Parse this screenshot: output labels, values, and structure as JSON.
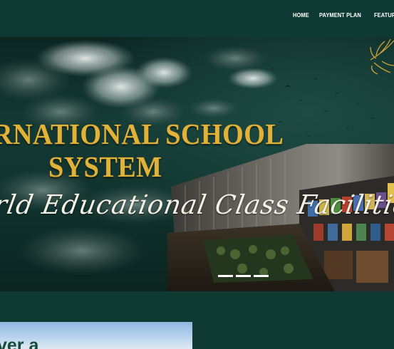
{
  "nav": {
    "items": [
      {
        "label": "HOME"
      },
      {
        "label": "PAYMENT PLAN"
      },
      {
        "label": "FEATUR"
      }
    ]
  },
  "hero": {
    "title_line1": "RNATIONAL SCHOOL",
    "title_line2": "SYSTEM",
    "tagline": "rld Educational Class Facilities",
    "slide_count": 3,
    "active_slide": 1
  },
  "section": {
    "heading_partial": "ver a"
  },
  "colors": {
    "background": "#0f3a33",
    "title_gold": "#e0b23a",
    "nav_text": "#ffffff"
  },
  "icons": [
    "leaf-ornament-icon"
  ]
}
